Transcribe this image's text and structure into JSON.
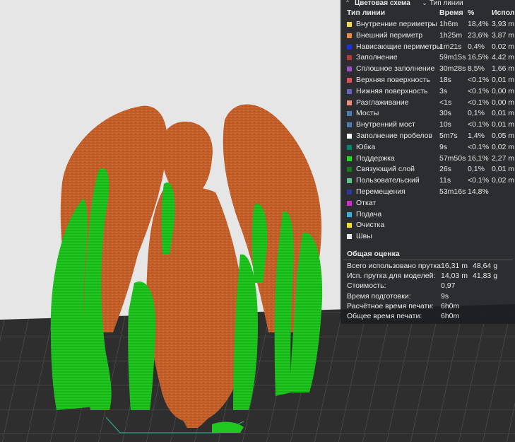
{
  "legend": {
    "color_scheme_label": "Цветовая схема",
    "type_select_value": "Тип линии",
    "headers": {
      "type": "Тип линии",
      "time": "Время",
      "percent": "%",
      "usage": "Исполь"
    },
    "rows": [
      {
        "label": "Внутренние периметры",
        "time": "1h6m",
        "percent": "18,4%",
        "usage": "3,93 m",
        "color": "#f5d94a"
      },
      {
        "label": "Внешний периметр",
        "time": "1h25m",
        "percent": "23,6%",
        "usage": "3,87 m",
        "color": "#e8894a"
      },
      {
        "label": "Нависающие периметры",
        "time": "1m21s",
        "percent": "0,4%",
        "usage": "0,02 m",
        "color": "#1f2fe0"
      },
      {
        "label": "Заполнение",
        "time": "59m15s",
        "percent": "16,5%",
        "usage": "4,42 m",
        "color": "#b13a3a"
      },
      {
        "label": "Сплошное заполнение",
        "time": "30m28s",
        "percent": "8,5%",
        "usage": "1,66 m",
        "color": "#9a52c8"
      },
      {
        "label": "Верхняя поверхность",
        "time": "18s",
        "percent": "<0.1%",
        "usage": "0,01 m",
        "color": "#e04e5a"
      },
      {
        "label": "Нижняя поверхность",
        "time": "3s",
        "percent": "<0.1%",
        "usage": "0,00 m",
        "color": "#6a63c0"
      },
      {
        "label": "Разглаживание",
        "time": "<1s",
        "percent": "<0.1%",
        "usage": "0,00 m",
        "color": "#f08d7a"
      },
      {
        "label": "Мосты",
        "time": "30s",
        "percent": "0,1%",
        "usage": "0,01 m",
        "color": "#4d7cb0"
      },
      {
        "label": "Внутренний мост",
        "time": "10s",
        "percent": "<0.1%",
        "usage": "0,01 m",
        "color": "#4d7cb0"
      },
      {
        "label": "Заполнение пробелов",
        "time": "5m7s",
        "percent": "1,4%",
        "usage": "0,05 m",
        "color": "#ffffff"
      },
      {
        "label": "Юбка",
        "time": "9s",
        "percent": "<0.1%",
        "usage": "0,02 m",
        "color": "#00876e"
      },
      {
        "label": "Поддержка",
        "time": "57m50s",
        "percent": "16,1%",
        "usage": "2,27 m",
        "color": "#19e019"
      },
      {
        "label": "Связующий слой",
        "time": "26s",
        "percent": "0,1%",
        "usage": "0,01 m",
        "color": "#1a7a1a"
      },
      {
        "label": "Пользовательский",
        "time": "11s",
        "percent": "<0.1%",
        "usage": "0,02 m",
        "color": "#5ec08a"
      },
      {
        "label": "Перемещения",
        "time": "53m16s",
        "percent": "14,8%",
        "usage": "",
        "color": "#2d3a9a"
      },
      {
        "label": "Откат",
        "time": "",
        "percent": "",
        "usage": "",
        "color": "#d02ad0"
      },
      {
        "label": "Подача",
        "time": "",
        "percent": "",
        "usage": "",
        "color": "#3aaed8"
      },
      {
        "label": "Очистка",
        "time": "",
        "percent": "",
        "usage": "",
        "color": "#f0e020"
      },
      {
        "label": "Швы",
        "time": "",
        "percent": "",
        "usage": "",
        "color": "#e8e8e8"
      }
    ]
  },
  "estimate": {
    "title": "Общая оценка",
    "rows": [
      {
        "label": "Всего использовано прутка:",
        "v1": "16,31 m",
        "v2": "48,64 g"
      },
      {
        "label": "Исп. прутка для моделей:",
        "v1": "14,03 m",
        "v2": "41,83 g"
      },
      {
        "label": "Стоимость:",
        "v1": "0,97",
        "v2": ""
      },
      {
        "label": "Время подготовки:",
        "v1": "9s",
        "v2": ""
      },
      {
        "label": "Расчётное время печати:",
        "v1": "6h0m",
        "v2": ""
      },
      {
        "label": "Общее время печати:",
        "v1": "6h0m",
        "v2": ""
      }
    ]
  },
  "colors": {
    "model_orange": "#c8622a",
    "support_green": "#1ec81e",
    "bed": "#2e2e2e",
    "background": "#e6e6e6"
  }
}
